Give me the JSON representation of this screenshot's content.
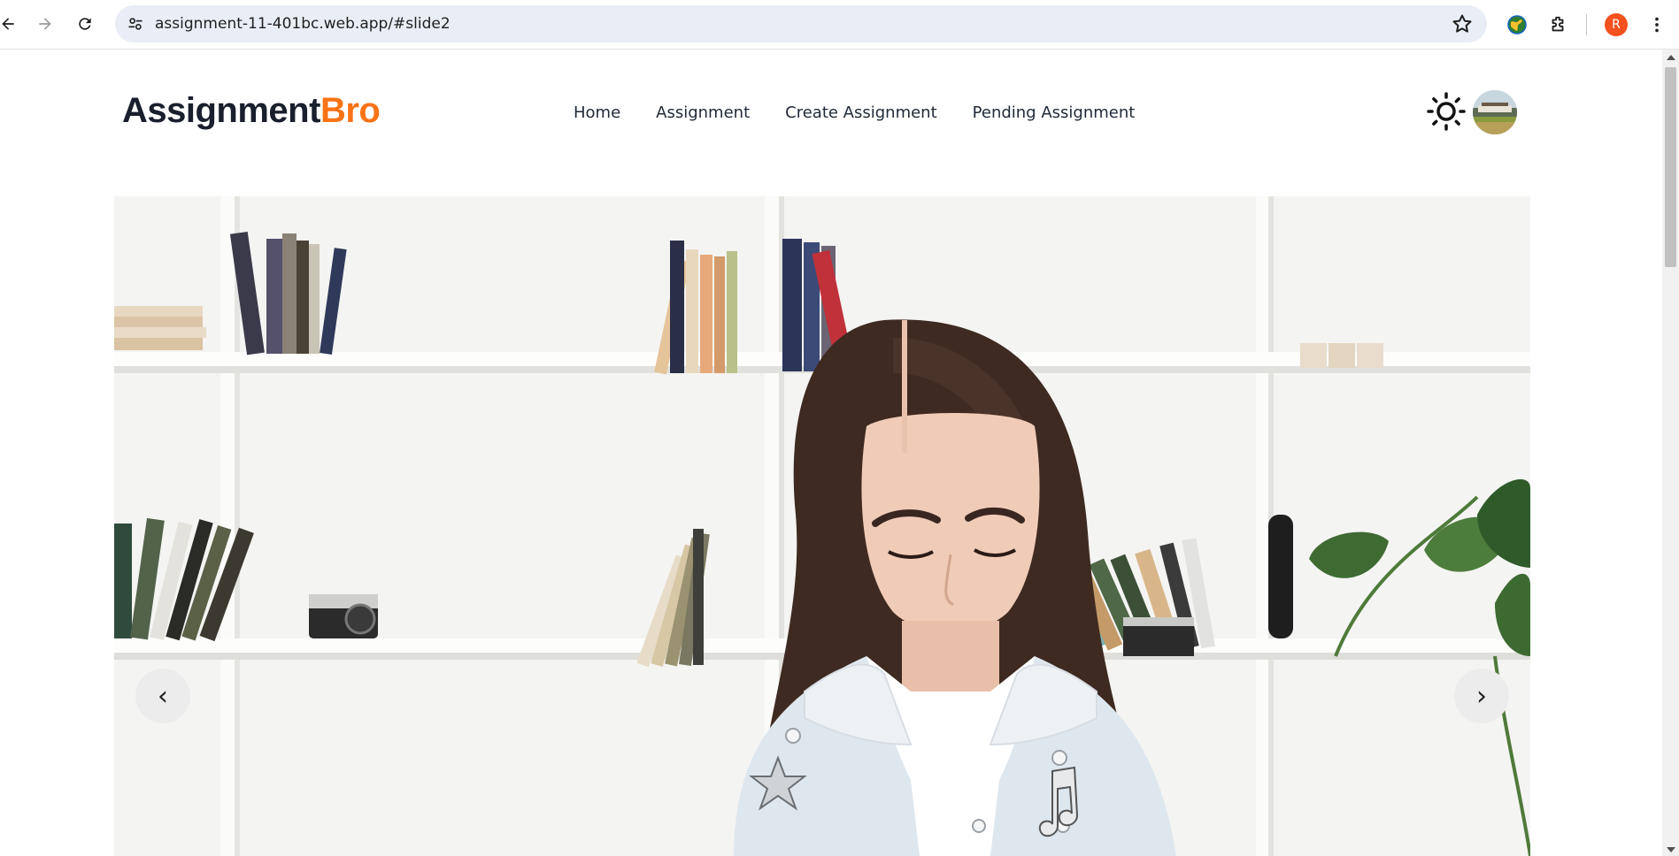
{
  "browser": {
    "url": "assignment-11-401bc.web.app/#slide2",
    "profile_initial": "R"
  },
  "site": {
    "logo_part1": "Assignment",
    "logo_part2": "Bro",
    "accent_color": "#f97316",
    "nav": [
      {
        "label": "Home"
      },
      {
        "label": "Assignment"
      },
      {
        "label": "Create Assignment"
      },
      {
        "label": "Pending Assignment"
      }
    ],
    "theme_icon": "sun-icon"
  },
  "carousel": {
    "prev_label": "‹",
    "next_label": "›",
    "current_slide": 2
  }
}
